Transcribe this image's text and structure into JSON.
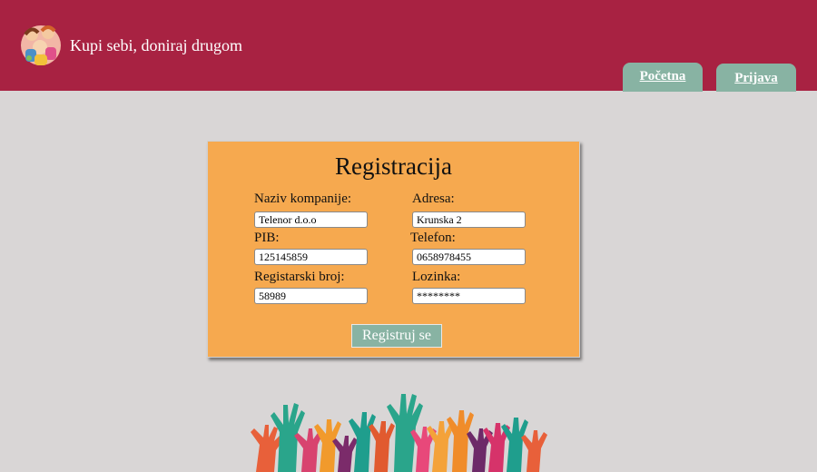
{
  "header": {
    "site_title": "Kupi sebi, doniraj drugom",
    "tabs": [
      {
        "label": "Početna"
      },
      {
        "label": "Prijava"
      }
    ],
    "logo_icon": "children-group-logo"
  },
  "form": {
    "title": "Registracija",
    "fields": [
      {
        "label": "Naziv kompanije:",
        "value": "Telenor d.o.o"
      },
      {
        "label": "Adresa:",
        "value": "Krunska 2"
      },
      {
        "label": "PIB:",
        "value": "125145859"
      },
      {
        "label": "Telefon:",
        "value": "0658978455"
      },
      {
        "label": "Registarski broj:",
        "value": "58989"
      },
      {
        "label": "Lozinka:",
        "value": "********"
      }
    ],
    "submit_label": "Registruj se"
  },
  "colors": {
    "header": "#a82242",
    "background": "#d9d6d6",
    "card": "#f6a94f",
    "accent": "#88b3a3"
  }
}
